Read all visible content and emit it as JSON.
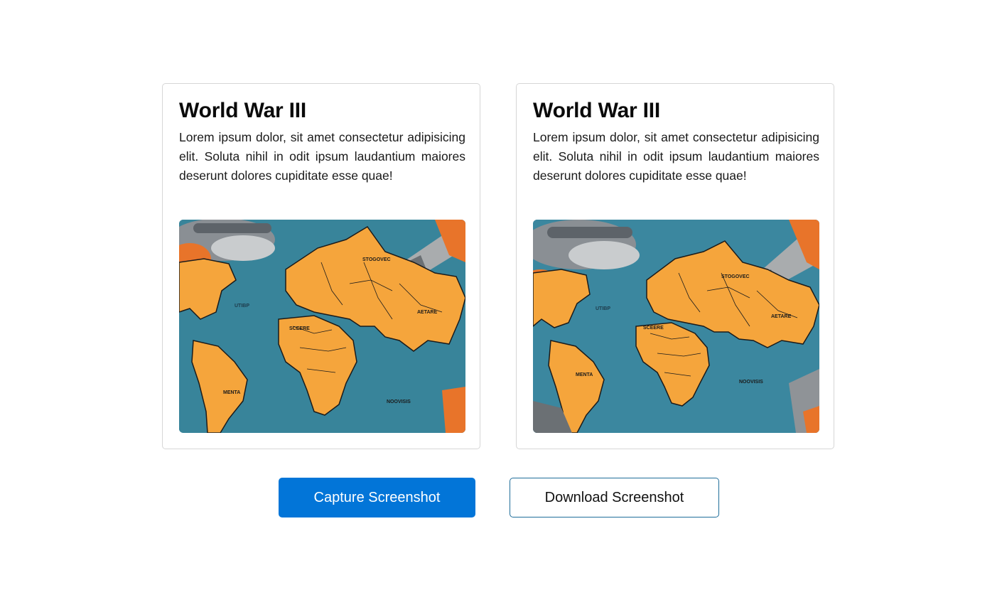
{
  "cards": [
    {
      "title": "World War III",
      "text": "Lorem ipsum dolor, sit amet consectetur adipisicing elit. Soluta nihil in odit ipsum laudantium maiores deserunt dolores cupiditate esse quae!",
      "image": {
        "map_labels": [
          "STOGOVEC",
          "UTIBP",
          "AETARE",
          "SCEERE",
          "MENTA",
          "NOOVISIS"
        ]
      }
    },
    {
      "title": "World War III",
      "text": "Lorem ipsum dolor, sit amet consectetur adipisicing elit. Soluta nihil in odit ipsum laudantium maiores deserunt dolores cupiditate esse quae!",
      "image": {
        "map_labels": [
          "STOGOVEC",
          "UTIBP",
          "AETARE",
          "SCEERE",
          "MENTA",
          "NOOVISIS"
        ]
      }
    }
  ],
  "buttons": {
    "capture_label": "Capture Screenshot",
    "download_label": "Download Screenshot"
  },
  "colors": {
    "primary": "#0275d8",
    "ocean": "#3d8aa0",
    "land": "#f5a53c",
    "accent_orange": "#e8742a"
  }
}
